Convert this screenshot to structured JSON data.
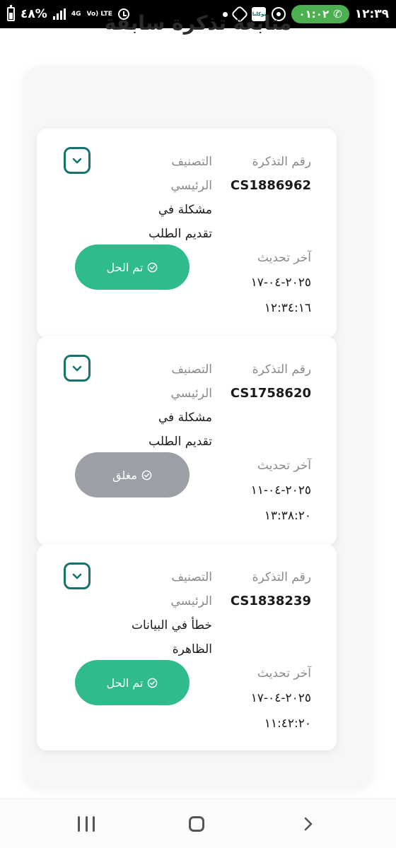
{
  "status_bar": {
    "time": "١٢:٣٩",
    "battery": "٤٨%",
    "network": "4G",
    "volte": "Vo) LTE",
    "call_timer": "٠١:٠٢",
    "tawakkalna_label": "توكلنا"
  },
  "page": {
    "title": "متابعة تذكرة سابقة"
  },
  "labels": {
    "ticket_number": "رقم التذكرة",
    "category": "التصنيف",
    "category_main": "الرئيسي",
    "last_update": "آخر تحديث"
  },
  "tickets": [
    {
      "number": "CS1886962",
      "category_line1": "مشكلة في",
      "category_line2": "تقديم الطلب",
      "date": "٢٠٢٥-٠٤-١٧",
      "time": "١٢:٣٤:١٦",
      "status": "تم الحل"
    },
    {
      "number": "CS1758620",
      "category_line1": "مشكلة في",
      "category_line2": "تقديم الطلب",
      "date": "٢٠٢٥-٠٤-١١",
      "time": "١٣:٣٨:٢٠",
      "status": "مغلق"
    },
    {
      "number": "CS1838239",
      "category_line1": "خطأ في البيانات",
      "category_line2": "الظاهرة",
      "date": "٢٠٢٥-٠٤-١٧",
      "time": "١١:٤٢:٢٠",
      "status": "تم الحل"
    }
  ],
  "colors": {
    "accent": "#16726d",
    "resolved": "#2fbb8a",
    "closed": "#9aa0a6"
  }
}
